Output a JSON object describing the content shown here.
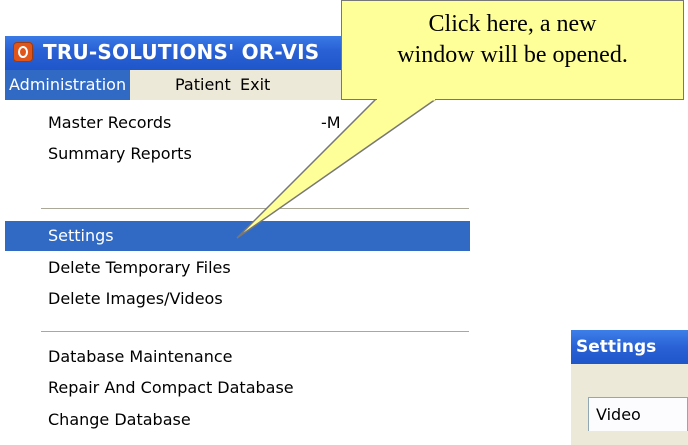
{
  "window": {
    "title": "TRU-SOLUTIONS' OR-VIS"
  },
  "menubar": {
    "items": [
      {
        "label": "Administration"
      },
      {
        "label": "Patient"
      },
      {
        "label": "Exit"
      }
    ]
  },
  "dropdown": {
    "items": [
      {
        "label": "Master Records"
      },
      {
        "label": "Summary Reports"
      },
      {
        "label": "Settings"
      },
      {
        "label": "Delete Temporary Files"
      },
      {
        "label": "Delete Images/Videos"
      },
      {
        "label": "Database Maintenance"
      },
      {
        "label": "Repair And Compact Database"
      },
      {
        "label": "Change Database"
      }
    ],
    "obscured_fragment": "-M"
  },
  "callout": {
    "text": "Click here, a new\nwindow will be opened."
  },
  "settings_window": {
    "title": "Settings",
    "tab_label": "Video"
  },
  "colors": {
    "title_bar": "#2a62d6",
    "menu_highlight": "#316ac5",
    "callout_fill": "#ffff99",
    "menu_bar": "#ece9d8"
  }
}
